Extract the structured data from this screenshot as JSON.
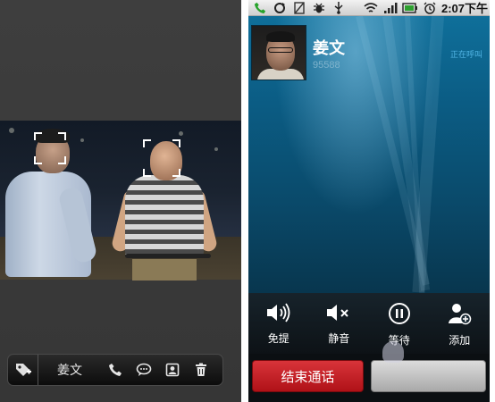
{
  "left": {
    "bottom_bar": {
      "tag_icon": "tag-add-icon",
      "name": "姜文",
      "actions": [
        {
          "icon": "phone-icon"
        },
        {
          "icon": "message-icon"
        },
        {
          "icon": "contact-card-icon"
        },
        {
          "icon": "trash-icon"
        }
      ]
    }
  },
  "right": {
    "status_bar": {
      "icons": [
        "call-active-icon",
        "sync-icon",
        "no-sim-icon",
        "debug-icon",
        "usb-icon",
        "wifi-icon",
        "signal-icon",
        "battery-icon",
        "alarm-icon"
      ],
      "time": "2:07下午"
    },
    "caller": {
      "name": "姜文",
      "number": "95588",
      "status": "正在呼叫"
    },
    "actions": [
      {
        "label": "免提",
        "icon": "speaker-icon"
      },
      {
        "label": "静音",
        "icon": "mute-icon"
      },
      {
        "label": "等待",
        "icon": "hold-icon"
      },
      {
        "label": "添加",
        "icon": "add-call-icon"
      }
    ],
    "end_call": "结束通话",
    "colors": {
      "end_call": "#c4222a",
      "accent": "#52b6e6"
    }
  }
}
